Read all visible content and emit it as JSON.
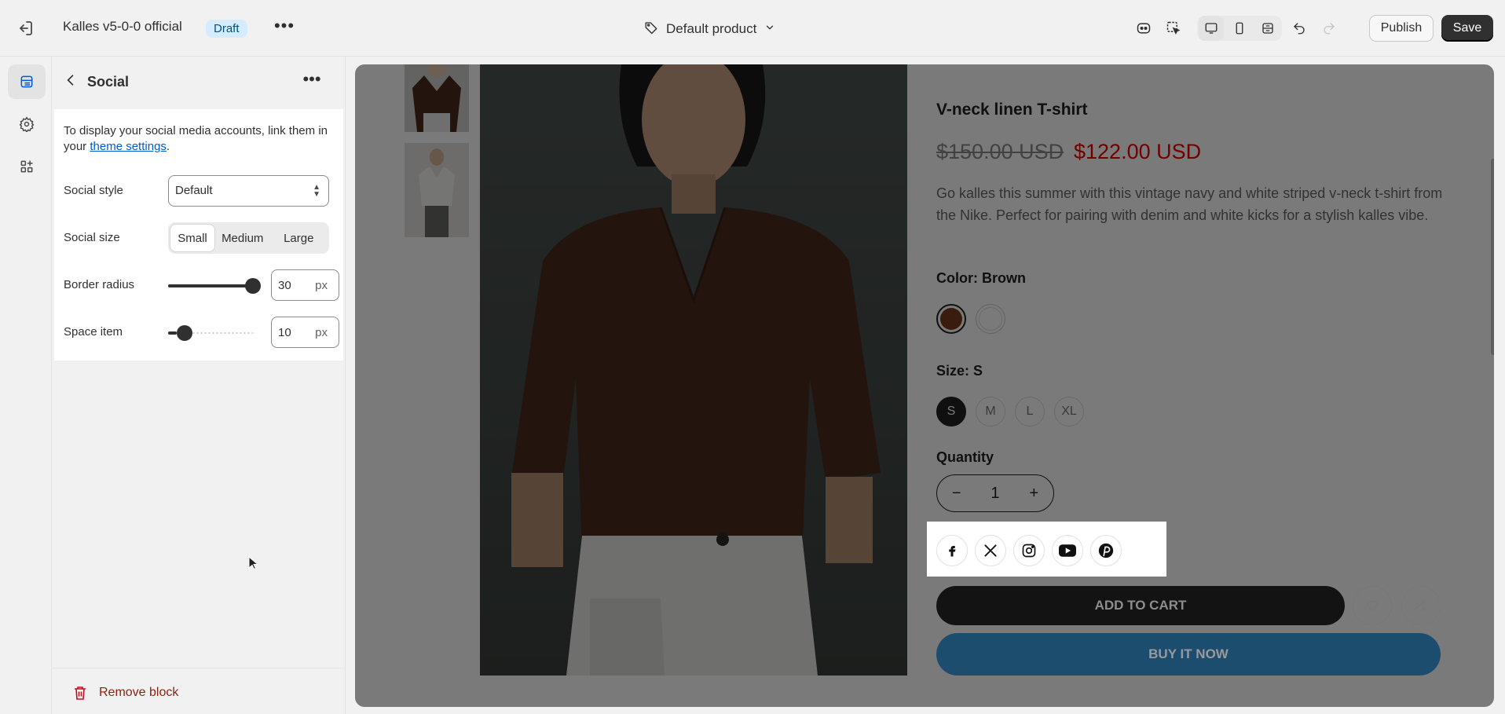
{
  "topbar": {
    "store_name": "Kalles v5-0-0 official",
    "status_badge": "Draft",
    "template_selector": "Default product",
    "publish_label": "Publish",
    "save_label": "Save"
  },
  "sidebar": {
    "title": "Social",
    "info_text": "To display your social media accounts, link them in your ",
    "info_link": "theme settings",
    "info_end": ".",
    "settings": {
      "social_style": {
        "label": "Social style",
        "value": "Default"
      },
      "social_size": {
        "label": "Social size",
        "options": [
          "Small",
          "Medium",
          "Large"
        ],
        "selected": "Small"
      },
      "border_radius": {
        "label": "Border radius",
        "value": "30",
        "unit": "px",
        "level": 1.0
      },
      "space_item": {
        "label": "Space item",
        "value": "10",
        "unit": "px",
        "level": 0.1
      }
    },
    "remove_label": "Remove block"
  },
  "product": {
    "title": "V-neck linen T-shirt",
    "old_price": "$150.00 USD",
    "price": "$122.00 USD",
    "description": "Go kalles this summer with this vintage navy and white striped v-neck t-shirt from the Nike. Perfect for pairing with denim and white kicks for a stylish kalles vibe.",
    "color_label": "Color: Brown",
    "colors": [
      {
        "name": "brown",
        "hex": "#7a3b1e",
        "selected": true
      },
      {
        "name": "white",
        "hex": "#ffffff",
        "selected": false
      }
    ],
    "size_label": "Size: S",
    "sizes": [
      "S",
      "M",
      "L",
      "XL"
    ],
    "selected_size": "S",
    "quantity_label": "Quantity",
    "quantity": "1",
    "social_icons": [
      "facebook-icon",
      "x-twitter-icon",
      "instagram-icon",
      "youtube-icon",
      "pinterest-icon"
    ],
    "add_to_cart": "ADD TO CART",
    "buy_now": "BUY IT NOW"
  },
  "colors": {
    "accent": "#005bd3",
    "danger": "#c70a24",
    "buy_now": "#2f7fb8",
    "sale_price": "#ec0101"
  }
}
